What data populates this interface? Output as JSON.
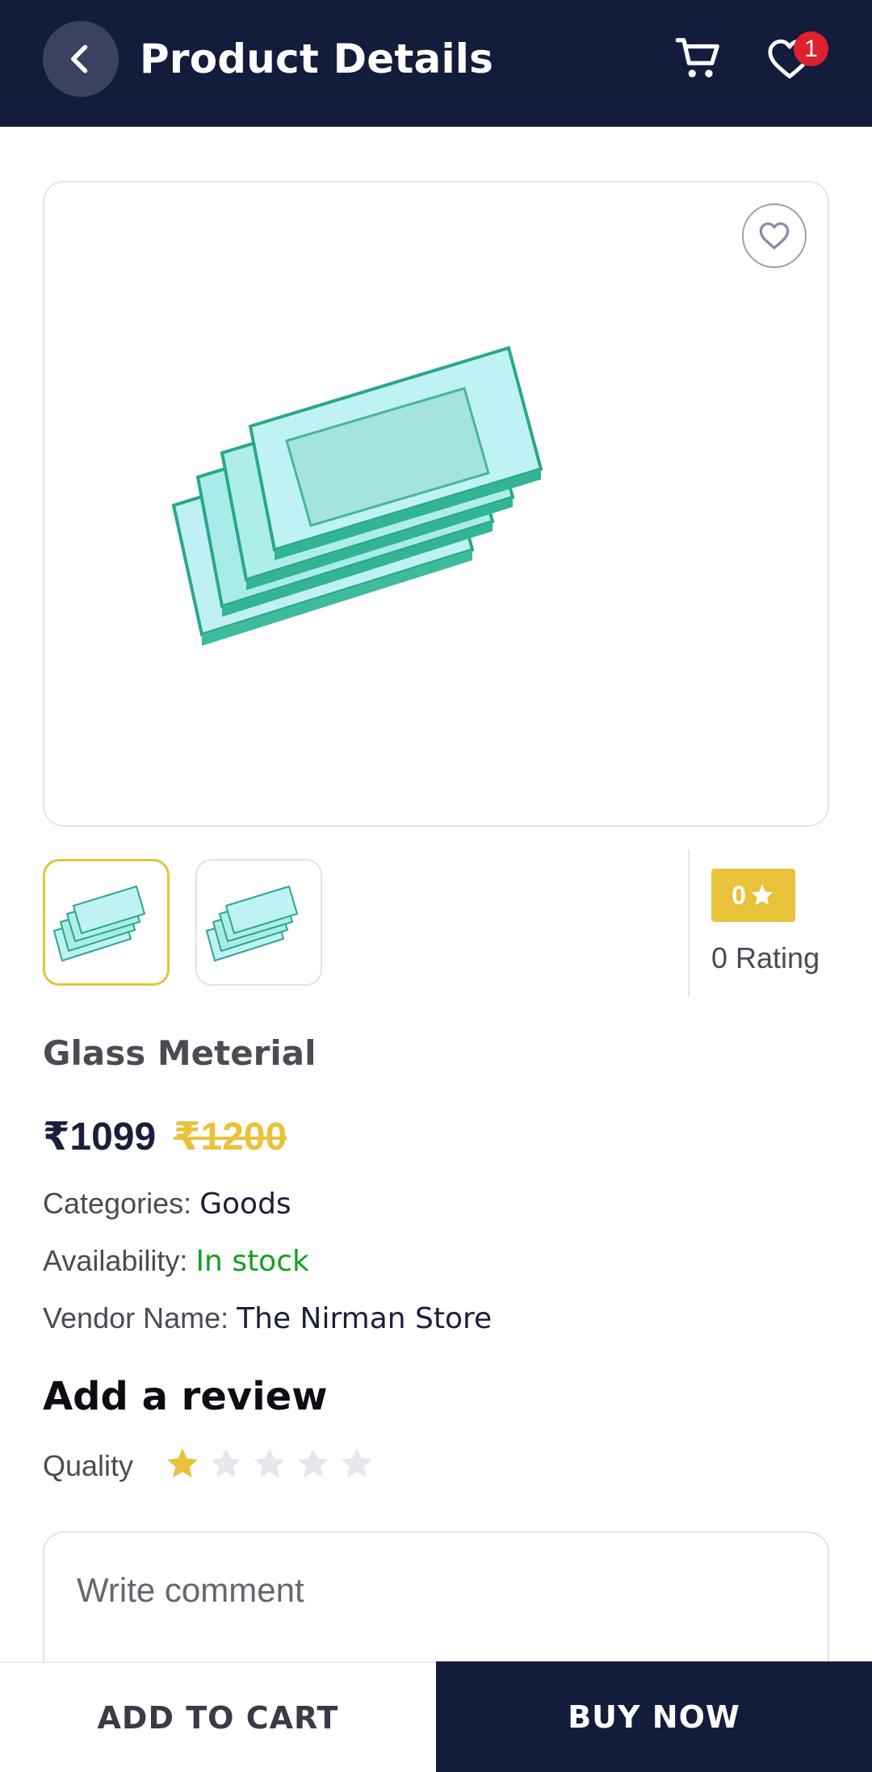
{
  "header": {
    "title": "Product Details",
    "wishlist_count": "1",
    "icons": [
      "back-arrow-icon",
      "cart-icon",
      "heart-icon"
    ]
  },
  "product": {
    "name": "Glass Meterial",
    "price": "₹1099",
    "old_price": "₹1200",
    "rating_value": "0",
    "rating_text": "0 Rating",
    "categories_label": "Categories:",
    "categories_value": "Goods",
    "availability_label": "Availability:",
    "availability_value": "In stock",
    "vendor_label": "Vendor Name:",
    "vendor_value": "The Nirman Store"
  },
  "review": {
    "title": "Add a review",
    "quality_label": "Quality",
    "quality_rating": 1,
    "quality_max": 5,
    "comment_placeholder": "Write comment"
  },
  "actions": {
    "add_to_cart": "ADD TO CART",
    "buy_now": "BUY NOW"
  },
  "colors": {
    "primary": "#131c3a",
    "accent": "#e9c23b",
    "success": "#14a020",
    "badge": "#e0202f"
  }
}
